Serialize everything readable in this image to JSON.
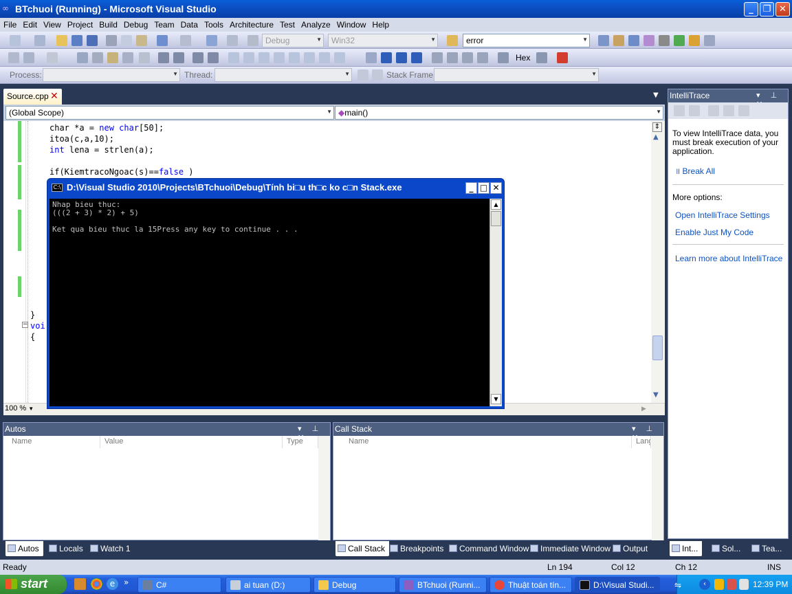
{
  "window": {
    "title": "BTchuoi (Running) - Microsoft Visual Studio"
  },
  "menu": [
    "File",
    "Edit",
    "View",
    "Project",
    "Build",
    "Debug",
    "Team",
    "Data",
    "Tools",
    "Architecture",
    "Test",
    "Analyze",
    "Window",
    "Help"
  ],
  "toolbar": {
    "config": "Debug",
    "platform": "Win32",
    "find_value": "error",
    "hex_label": "Hex"
  },
  "debug_location": {
    "process_label": "Process:",
    "thread_label": "Thread:",
    "stack_frame_label": "Stack Frame:"
  },
  "document": {
    "tab": "Source.cpp",
    "scope": "(Global Scope)",
    "function": "main()",
    "zoom": "100 %"
  },
  "code_lines": [
    {
      "pre": "char *a = ",
      "kw": "new char",
      "post": "[50];"
    },
    {
      "pre": "itoa(c,a,10);",
      "kw": "",
      "post": ""
    },
    {
      "pre": "",
      "kw": "int",
      "post": " lena = strlen(a);"
    },
    {
      "pre": "if(KiemtracoNgoac(s)==",
      "kw": "false",
      "post": " )"
    }
  ],
  "code_fragments": {
    "brace_close": "}",
    "void_partial": "voi",
    "brace_open": "{"
  },
  "console": {
    "title": "D:\\Visual Studio 2010\\Projects\\BTchuoi\\Debug\\Tính bi□u th□c ko c□n Stack.exe",
    "lines": [
      "Nhap bieu thuc:",
      "(((2 + 3) * 2) + 5)",
      "",
      "Ket qua bieu thuc la 15Press any key to continue . . ."
    ]
  },
  "intellitrace": {
    "header": "IntelliTrace",
    "message": "To view IntelliTrace data, you must break execution of your application.",
    "break_all": "Break All",
    "more_options": "More options:",
    "links": [
      "Open IntelliTrace Settings",
      "Enable Just My Code",
      "Learn more about IntelliTrace"
    ]
  },
  "autos": {
    "header": "Autos",
    "columns": [
      "Name",
      "Value",
      "Type"
    ]
  },
  "callstack": {
    "header": "Call Stack",
    "columns": [
      "Name",
      "Langu"
    ]
  },
  "bottom_tabs_left": [
    "Autos",
    "Locals",
    "Watch 1"
  ],
  "bottom_tabs_right": [
    "Call Stack",
    "Breakpoints",
    "Command Window",
    "Immediate Window",
    "Output"
  ],
  "right_tabs": [
    "Int...",
    "Sol...",
    "Tea..."
  ],
  "status": {
    "text": "Ready",
    "ln": "Ln 194",
    "col": "Col 12",
    "ch": "Ch 12",
    "mode": "INS"
  },
  "taskbar": {
    "start": "start",
    "tasks": [
      "C#",
      "ai tuan (D:)",
      "Debug",
      "BTchuoi (Runni...",
      "Thuật toán tín...",
      "D:\\Visual Studi..."
    ],
    "clock": "12:39 PM"
  },
  "colors": {
    "accent": "#0a47c9",
    "vs_frame": "#293955",
    "panel_header": "#4d6082",
    "keyword": "#0000ff"
  }
}
